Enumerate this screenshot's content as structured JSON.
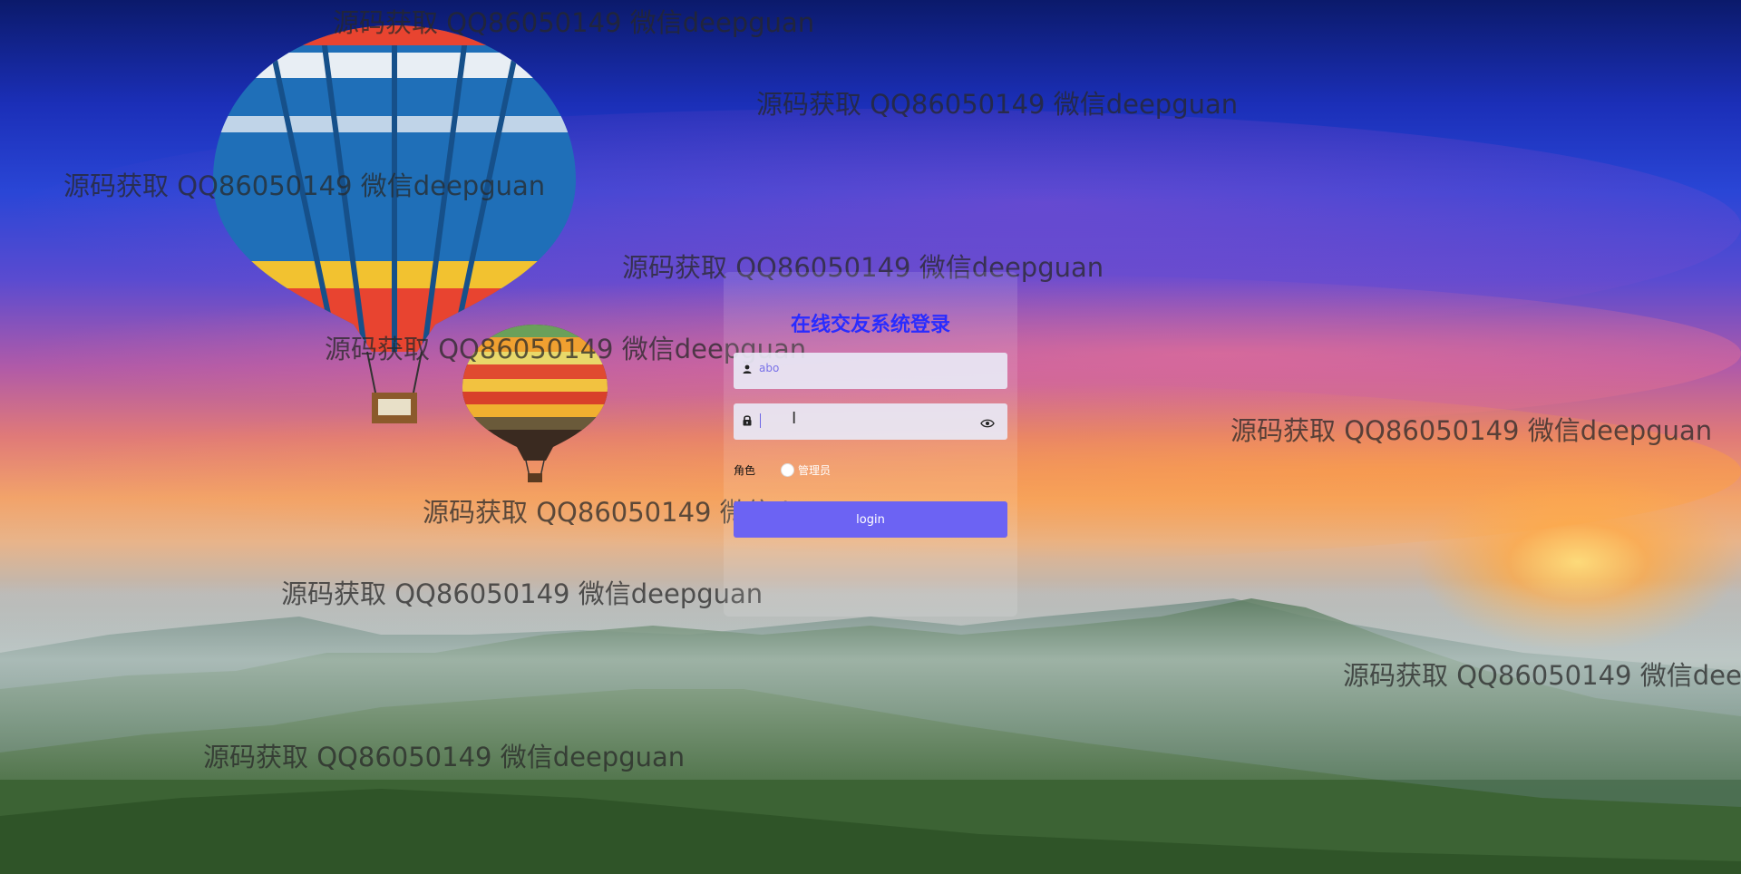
{
  "login": {
    "title": "在线交友系统登录",
    "username_value": "abo",
    "password_value": "",
    "role_label": "角色",
    "role_option": "管理员",
    "submit_label": "login"
  },
  "watermark": {
    "text": "源码获取 QQ86050149 微信deepguan"
  },
  "icons": {
    "user": "user-icon",
    "lock": "lock-icon",
    "eye": "eye-icon"
  },
  "colors": {
    "title": "#2a2cff",
    "button": "#6c63f3",
    "input_text": "#7a72e8"
  }
}
